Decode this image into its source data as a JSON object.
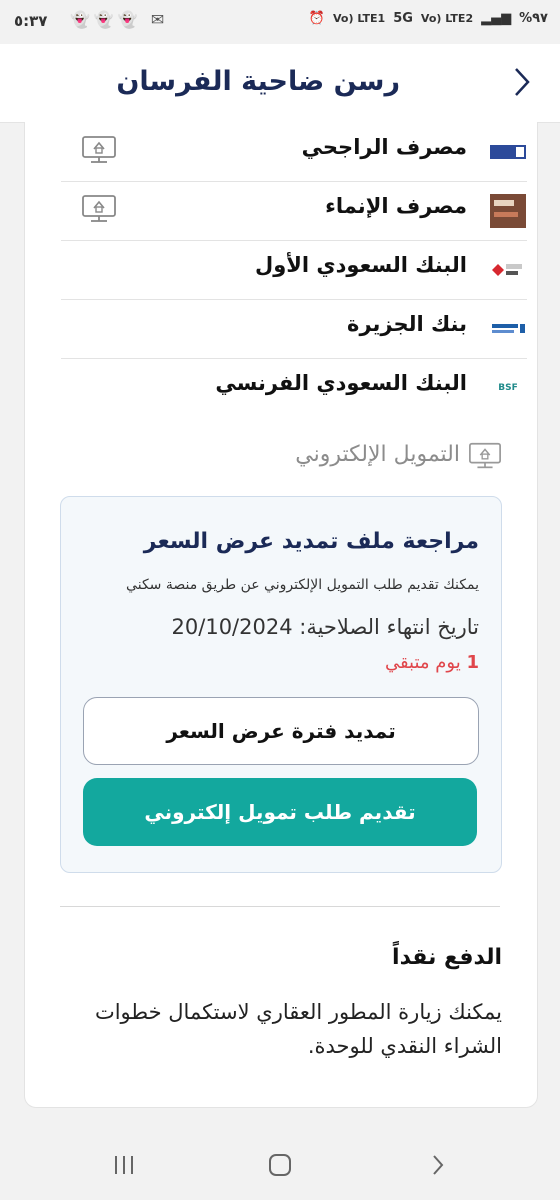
{
  "status_bar": {
    "time": "٥:٣٧",
    "battery": "%٩٧",
    "network1": "Vo) LTE2",
    "network2": "5G",
    "network3": "Vo) LTE1"
  },
  "header": {
    "title": "رسن ضاحية الفرسان",
    "back_icon": "chevron-right-icon"
  },
  "banks": [
    {
      "name": "مصرف الراجحي",
      "logo": "alrajhi-logo",
      "logo_color": "#2c4a9a",
      "has_online": true
    },
    {
      "name": "مصرف الإنماء",
      "logo": "alinma-logo",
      "logo_color": "#6b3a2a",
      "has_online": true
    },
    {
      "name": "البنك السعودي الأول",
      "logo": "sab-logo",
      "logo_color": "#d7282f",
      "has_online": false
    },
    {
      "name": "بنك الجزيرة",
      "logo": "aljazira-logo",
      "logo_color": "#1e5fa8",
      "has_online": false
    },
    {
      "name": "البنك السعودي الفرنسي",
      "logo": "bsf-logo",
      "logo_text": "BSF",
      "logo_color": "#1f8a8a",
      "has_online": false
    }
  ],
  "online_financing": {
    "title": "التمويل الإلكتروني",
    "box_title": "مراجعة ملف تمديد عرض السعر",
    "description": "يمكنك تقديم طلب التمويل الإلكتروني عن طريق منصة سكني",
    "expiry_label": "تاريخ انتهاء الصلاحية:",
    "expiry_date": "20/10/2024",
    "remaining_count": "1",
    "remaining_label": "يوم متبقي",
    "extend_button": "تمديد فترة عرض السعر",
    "submit_button": "تقديم طلب تمويل إلكتروني"
  },
  "cash_payment": {
    "title": "الدفع نقداً",
    "text": "يمكنك زيارة المطور العقاري لاستكمال خطوات الشراء النقدي للوحدة."
  },
  "colors": {
    "title": "#1b2a57",
    "primary": "#13a89e",
    "danger": "#e0464b",
    "box_bg": "#f4f8fb"
  }
}
